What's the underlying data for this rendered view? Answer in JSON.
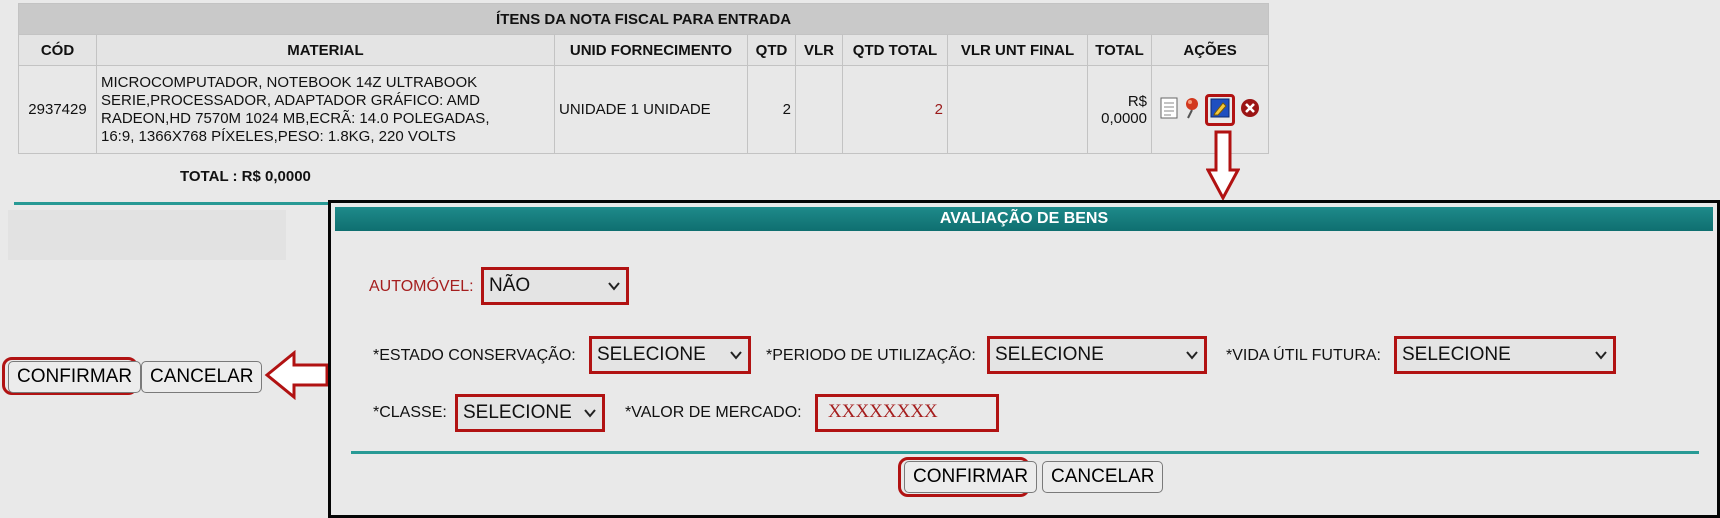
{
  "table": {
    "title": "ÍTENS DA NOTA FISCAL PARA ENTRADA",
    "headers": [
      "CÓD",
      "MATERIAL",
      "UNID FORNECIMENTO",
      "QTD",
      "VLR",
      "QTD TOTAL",
      "VLR UNT FINAL",
      "TOTAL",
      "AÇÕES"
    ],
    "row": {
      "cod": "2937429",
      "material_lines": [
        "MICROCOMPUTADOR, NOTEBOOK 14Z ULTRABOOK",
        "SERIE,PROCESSADOR, ADAPTADOR GRÁFICO: AMD",
        "RADEON,HD 7570M 1024 MB,ECRÃ: 14.0 POLEGADAS,",
        "16:9, 1366X768 PÍXELES,PESO: 1.8KG, 220 VOLTS"
      ],
      "unid": "UNIDADE 1 UNIDADE",
      "qtd": "2",
      "vlr": "",
      "qtd_total": "2",
      "vlr_unt_final": "",
      "total_line1": "R$",
      "total_line2": "0,0000"
    },
    "actions": [
      "document-icon",
      "pin-icon",
      "edit-icon",
      "delete-icon"
    ]
  },
  "total_label": "TOTAL : R$ 0,0000",
  "left_buttons": {
    "confirm": "CONFIRMAR",
    "cancel": "CANCELAR"
  },
  "popup": {
    "title": "AVALIAÇÃO DE BENS",
    "automovel": {
      "label": "AUTOMÓVEL:",
      "value": "NÃO"
    },
    "estado": {
      "label": "*ESTADO CONSERVAÇÃO:",
      "value": "SELECIONE"
    },
    "periodo": {
      "label": "*PERIODO DE UTILIZAÇÃO:",
      "value": "SELECIONE"
    },
    "vida": {
      "label": "*VIDA ÚTIL FUTURA:",
      "value": "SELECIONE"
    },
    "classe": {
      "label": "*CLASSE:",
      "value": "SELECIONE"
    },
    "valor": {
      "label": "*VALOR DE MERCADO:",
      "value": "XXXXXXXX"
    },
    "confirm": "CONFIRMAR",
    "cancel": "CANCELAR"
  },
  "colors": {
    "accent_teal": "#289a95",
    "highlight_red": "#b11212",
    "header_gray": "#c9c9c9"
  }
}
